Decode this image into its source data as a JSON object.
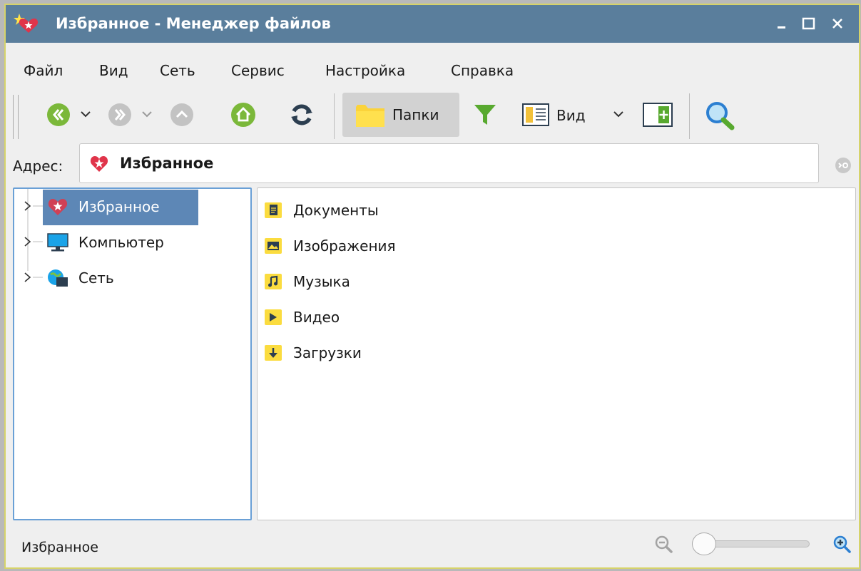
{
  "window": {
    "title": "Избранное - Менеджер файлов"
  },
  "menu": [
    "Файл",
    "Вид",
    "Сеть",
    "Сервис",
    "Настройка",
    "Справка"
  ],
  "toolbar": {
    "folders_label": "Папки",
    "view_label": "Вид"
  },
  "address": {
    "label": "Адрес:",
    "value": "Избранное"
  },
  "tree": [
    {
      "label": "Избранное",
      "icon": "favorites-icon",
      "selected": true
    },
    {
      "label": "Компьютер",
      "icon": "computer-icon",
      "selected": false
    },
    {
      "label": "Сеть",
      "icon": "network-icon",
      "selected": false
    }
  ],
  "files": [
    {
      "label": "Документы",
      "icon": "documents-folder-icon"
    },
    {
      "label": "Изображения",
      "icon": "pictures-folder-icon"
    },
    {
      "label": "Музыка",
      "icon": "music-folder-icon"
    },
    {
      "label": "Видео",
      "icon": "video-folder-icon"
    },
    {
      "label": "Загрузки",
      "icon": "downloads-folder-icon"
    }
  ],
  "status": {
    "text": "Избранное",
    "zoom_level": 0
  },
  "colors": {
    "titlebar": "#5a7e9c",
    "selection": "#5d87b6",
    "nav_green": "#7bb83a",
    "folder_yellow": "#fbdc3f"
  }
}
